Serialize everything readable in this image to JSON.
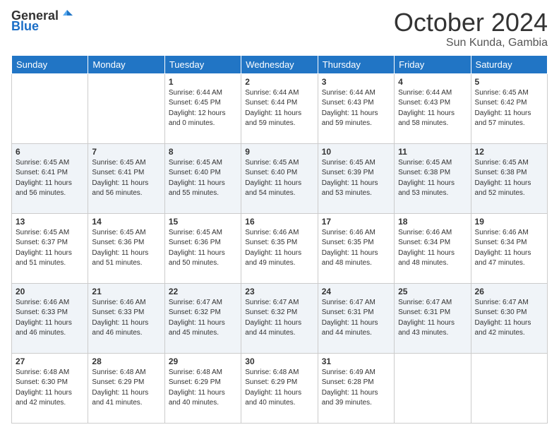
{
  "header": {
    "logo_general": "General",
    "logo_blue": "Blue",
    "month": "October 2024",
    "location": "Sun Kunda, Gambia"
  },
  "weekdays": [
    "Sunday",
    "Monday",
    "Tuesday",
    "Wednesday",
    "Thursday",
    "Friday",
    "Saturday"
  ],
  "weeks": [
    [
      {
        "day": "",
        "sunrise": "",
        "sunset": "",
        "daylight": ""
      },
      {
        "day": "",
        "sunrise": "",
        "sunset": "",
        "daylight": ""
      },
      {
        "day": "1",
        "sunrise": "Sunrise: 6:44 AM",
        "sunset": "Sunset: 6:45 PM",
        "daylight": "Daylight: 12 hours and 0 minutes."
      },
      {
        "day": "2",
        "sunrise": "Sunrise: 6:44 AM",
        "sunset": "Sunset: 6:44 PM",
        "daylight": "Daylight: 11 hours and 59 minutes."
      },
      {
        "day": "3",
        "sunrise": "Sunrise: 6:44 AM",
        "sunset": "Sunset: 6:43 PM",
        "daylight": "Daylight: 11 hours and 59 minutes."
      },
      {
        "day": "4",
        "sunrise": "Sunrise: 6:44 AM",
        "sunset": "Sunset: 6:43 PM",
        "daylight": "Daylight: 11 hours and 58 minutes."
      },
      {
        "day": "5",
        "sunrise": "Sunrise: 6:45 AM",
        "sunset": "Sunset: 6:42 PM",
        "daylight": "Daylight: 11 hours and 57 minutes."
      }
    ],
    [
      {
        "day": "6",
        "sunrise": "Sunrise: 6:45 AM",
        "sunset": "Sunset: 6:41 PM",
        "daylight": "Daylight: 11 hours and 56 minutes."
      },
      {
        "day": "7",
        "sunrise": "Sunrise: 6:45 AM",
        "sunset": "Sunset: 6:41 PM",
        "daylight": "Daylight: 11 hours and 56 minutes."
      },
      {
        "day": "8",
        "sunrise": "Sunrise: 6:45 AM",
        "sunset": "Sunset: 6:40 PM",
        "daylight": "Daylight: 11 hours and 55 minutes."
      },
      {
        "day": "9",
        "sunrise": "Sunrise: 6:45 AM",
        "sunset": "Sunset: 6:40 PM",
        "daylight": "Daylight: 11 hours and 54 minutes."
      },
      {
        "day": "10",
        "sunrise": "Sunrise: 6:45 AM",
        "sunset": "Sunset: 6:39 PM",
        "daylight": "Daylight: 11 hours and 53 minutes."
      },
      {
        "day": "11",
        "sunrise": "Sunrise: 6:45 AM",
        "sunset": "Sunset: 6:38 PM",
        "daylight": "Daylight: 11 hours and 53 minutes."
      },
      {
        "day": "12",
        "sunrise": "Sunrise: 6:45 AM",
        "sunset": "Sunset: 6:38 PM",
        "daylight": "Daylight: 11 hours and 52 minutes."
      }
    ],
    [
      {
        "day": "13",
        "sunrise": "Sunrise: 6:45 AM",
        "sunset": "Sunset: 6:37 PM",
        "daylight": "Daylight: 11 hours and 51 minutes."
      },
      {
        "day": "14",
        "sunrise": "Sunrise: 6:45 AM",
        "sunset": "Sunset: 6:36 PM",
        "daylight": "Daylight: 11 hours and 51 minutes."
      },
      {
        "day": "15",
        "sunrise": "Sunrise: 6:45 AM",
        "sunset": "Sunset: 6:36 PM",
        "daylight": "Daylight: 11 hours and 50 minutes."
      },
      {
        "day": "16",
        "sunrise": "Sunrise: 6:46 AM",
        "sunset": "Sunset: 6:35 PM",
        "daylight": "Daylight: 11 hours and 49 minutes."
      },
      {
        "day": "17",
        "sunrise": "Sunrise: 6:46 AM",
        "sunset": "Sunset: 6:35 PM",
        "daylight": "Daylight: 11 hours and 48 minutes."
      },
      {
        "day": "18",
        "sunrise": "Sunrise: 6:46 AM",
        "sunset": "Sunset: 6:34 PM",
        "daylight": "Daylight: 11 hours and 48 minutes."
      },
      {
        "day": "19",
        "sunrise": "Sunrise: 6:46 AM",
        "sunset": "Sunset: 6:34 PM",
        "daylight": "Daylight: 11 hours and 47 minutes."
      }
    ],
    [
      {
        "day": "20",
        "sunrise": "Sunrise: 6:46 AM",
        "sunset": "Sunset: 6:33 PM",
        "daylight": "Daylight: 11 hours and 46 minutes."
      },
      {
        "day": "21",
        "sunrise": "Sunrise: 6:46 AM",
        "sunset": "Sunset: 6:33 PM",
        "daylight": "Daylight: 11 hours and 46 minutes."
      },
      {
        "day": "22",
        "sunrise": "Sunrise: 6:47 AM",
        "sunset": "Sunset: 6:32 PM",
        "daylight": "Daylight: 11 hours and 45 minutes."
      },
      {
        "day": "23",
        "sunrise": "Sunrise: 6:47 AM",
        "sunset": "Sunset: 6:32 PM",
        "daylight": "Daylight: 11 hours and 44 minutes."
      },
      {
        "day": "24",
        "sunrise": "Sunrise: 6:47 AM",
        "sunset": "Sunset: 6:31 PM",
        "daylight": "Daylight: 11 hours and 44 minutes."
      },
      {
        "day": "25",
        "sunrise": "Sunrise: 6:47 AM",
        "sunset": "Sunset: 6:31 PM",
        "daylight": "Daylight: 11 hours and 43 minutes."
      },
      {
        "day": "26",
        "sunrise": "Sunrise: 6:47 AM",
        "sunset": "Sunset: 6:30 PM",
        "daylight": "Daylight: 11 hours and 42 minutes."
      }
    ],
    [
      {
        "day": "27",
        "sunrise": "Sunrise: 6:48 AM",
        "sunset": "Sunset: 6:30 PM",
        "daylight": "Daylight: 11 hours and 42 minutes."
      },
      {
        "day": "28",
        "sunrise": "Sunrise: 6:48 AM",
        "sunset": "Sunset: 6:29 PM",
        "daylight": "Daylight: 11 hours and 41 minutes."
      },
      {
        "day": "29",
        "sunrise": "Sunrise: 6:48 AM",
        "sunset": "Sunset: 6:29 PM",
        "daylight": "Daylight: 11 hours and 40 minutes."
      },
      {
        "day": "30",
        "sunrise": "Sunrise: 6:48 AM",
        "sunset": "Sunset: 6:29 PM",
        "daylight": "Daylight: 11 hours and 40 minutes."
      },
      {
        "day": "31",
        "sunrise": "Sunrise: 6:49 AM",
        "sunset": "Sunset: 6:28 PM",
        "daylight": "Daylight: 11 hours and 39 minutes."
      },
      {
        "day": "",
        "sunrise": "",
        "sunset": "",
        "daylight": ""
      },
      {
        "day": "",
        "sunrise": "",
        "sunset": "",
        "daylight": ""
      }
    ]
  ]
}
